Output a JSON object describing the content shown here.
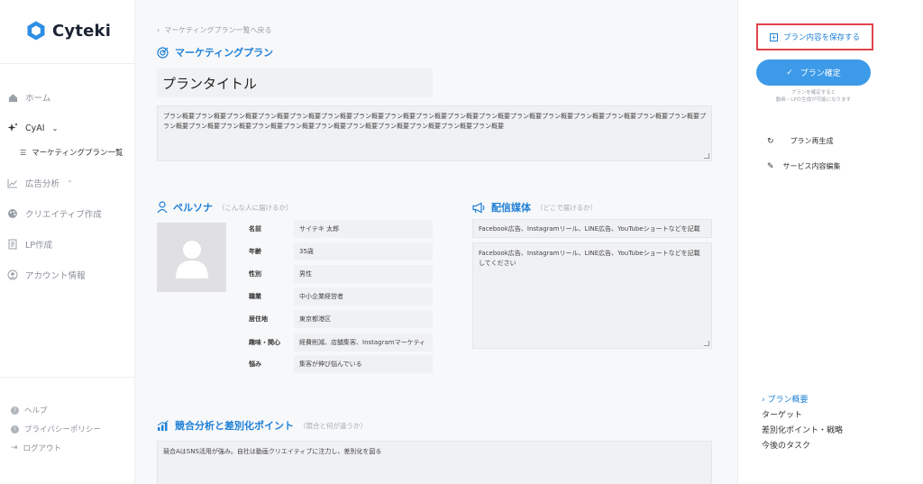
{
  "brand": {
    "name": "Cyteki"
  },
  "sidebar": {
    "nav": [
      {
        "label": "ホーム",
        "icon": "home-icon"
      },
      {
        "label": "CyAI",
        "icon": "sparkle-icon"
      },
      {
        "label": "広告分析",
        "icon": "chart-icon"
      },
      {
        "label": "クリエイティブ作成",
        "icon": "palette-icon"
      },
      {
        "label": "LP作成",
        "icon": "document-icon"
      },
      {
        "label": "アカウント情報",
        "icon": "user-icon"
      }
    ],
    "sub_item": "マーケティングプラン一覧",
    "footer": [
      {
        "label": "ヘルプ",
        "icon": "help-icon"
      },
      {
        "label": "プライバシーポリシー",
        "icon": "shield-icon"
      },
      {
        "label": "ログアウト",
        "icon": "logout-icon"
      }
    ]
  },
  "main": {
    "back_link": "マーケティングプラン一覧へ戻る",
    "marketing_title": "マーケティングプラン",
    "plan_title": "プランタイトル",
    "plan_summary": "プラン概要プラン概要プラン概要プラン概要プラン概要プラン概要プラン概要プラン概要プラン概要プラン概要プラン概要プラン概要プラン概要プラン概要プラン概要プラン概要プラン概要プラン概要プラン概要プラン概要プラン概要プラン概要プラン概要プラン概要プラン概要プラン概要プラン概要プラン概要",
    "persona": {
      "title": "ペルソナ",
      "subtitle": "（こんな人に届けるか）",
      "rows": [
        {
          "label": "名前",
          "value": "サイテキ 太郎"
        },
        {
          "label": "年齢",
          "value": "35歳"
        },
        {
          "label": "性別",
          "value": "男性"
        },
        {
          "label": "職業",
          "value": "中小企業経営者"
        },
        {
          "label": "居住地",
          "value": "東京都港区"
        },
        {
          "label": "趣味・関心",
          "value": "経費削減、店舗集客、Instagramマーケティ"
        },
        {
          "label": "悩み",
          "value": "集客が伸び悩んでいる"
        }
      ]
    },
    "media": {
      "title": "配信媒体",
      "subtitle": "（どこで届けるか）",
      "input_value": "Facebook広告、Instagramリール、LINE広告、YouTubeショートなどを記載",
      "textarea_value": "Facebook広告、Instagramリール、LINE広告、YouTubeショートなどを記載してください"
    },
    "competition": {
      "title": "競合分析と差別化ポイント",
      "subtitle": "（競合と何が違うか）",
      "value": "競合AはSNS活用が強み。自社は動画クリエイティブに注力し、差別化を図る"
    }
  },
  "right_panel": {
    "save_label": "プラン内容を保存する",
    "confirm_label": "プラン確定",
    "confirm_note_1": "プランを確定すると",
    "confirm_note_2": "動画・LPの生成が可能になります",
    "actions": [
      {
        "label": "プラン再生成",
        "icon": "refresh-icon"
      },
      {
        "label": "サービス内容編集",
        "icon": "edit-icon"
      }
    ],
    "toc": [
      "プラン概要",
      "ターゲット",
      "差別化ポイント・戦略",
      "今後のタスク"
    ]
  },
  "colors": {
    "accent": "#1e7fd6",
    "highlight": "#e0444c",
    "button": "#3d9ae8"
  }
}
